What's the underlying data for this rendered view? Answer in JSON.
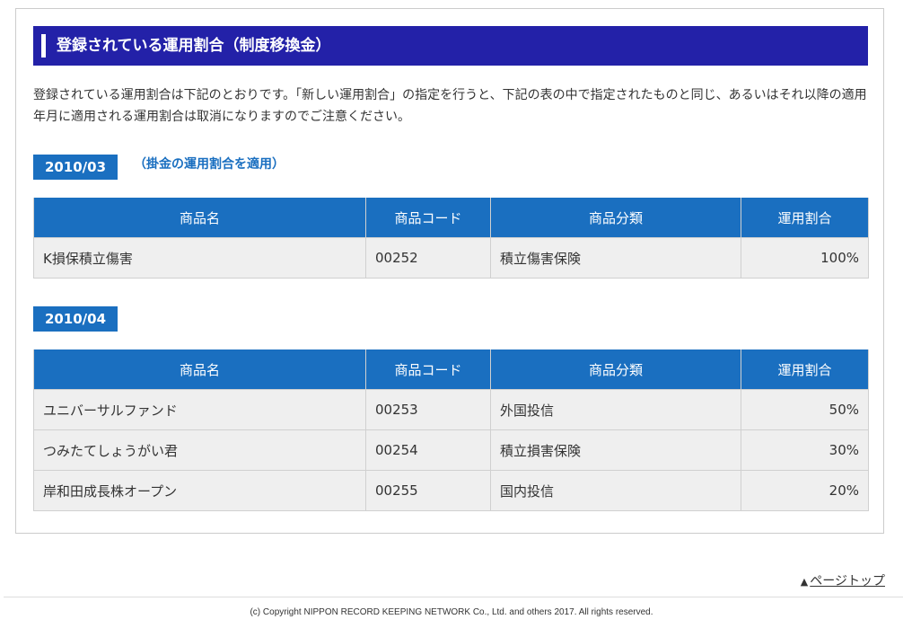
{
  "section": {
    "title": "登録されている運用割合（制度移換金）"
  },
  "intro": "登録されている運用割合は下記のとおりです。「新しい運用割合」の指定を行うと、下記の表の中で指定されたものと同じ、あるいはそれ以降の適用年月に適用される運用割合は取消になりますのでご注意ください。",
  "columns": {
    "name": "商品名",
    "code": "商品コード",
    "category": "商品分類",
    "ratio": "運用割合"
  },
  "periods": [
    {
      "date": "2010/03",
      "note": "（掛金の運用割合を適用）",
      "rows": [
        {
          "name": "K損保積立傷害",
          "code": "00252",
          "category": "積立傷害保険",
          "ratio": "100%"
        }
      ]
    },
    {
      "date": "2010/04",
      "note": "",
      "rows": [
        {
          "name": "ユニバーサルファンド",
          "code": "00253",
          "category": "外国投信",
          "ratio": "50%"
        },
        {
          "name": "つみたてしょうがい君",
          "code": "00254",
          "category": "積立損害保険",
          "ratio": "30%"
        },
        {
          "name": "岸和田成長株オープン",
          "code": "00255",
          "category": "国内投信",
          "ratio": "20%"
        }
      ]
    }
  ],
  "footer": {
    "pagetop_icon": "triangle-up-icon",
    "pagetop_label": "ページトップ",
    "copyright": "(c) Copyright NIPPON RECORD KEEPING NETWORK Co., Ltd. and others 2017. All rights reserved."
  },
  "colors": {
    "header_bg": "#2321a8",
    "accent_blue": "#1a6fc0",
    "row_bg": "#efefef"
  }
}
